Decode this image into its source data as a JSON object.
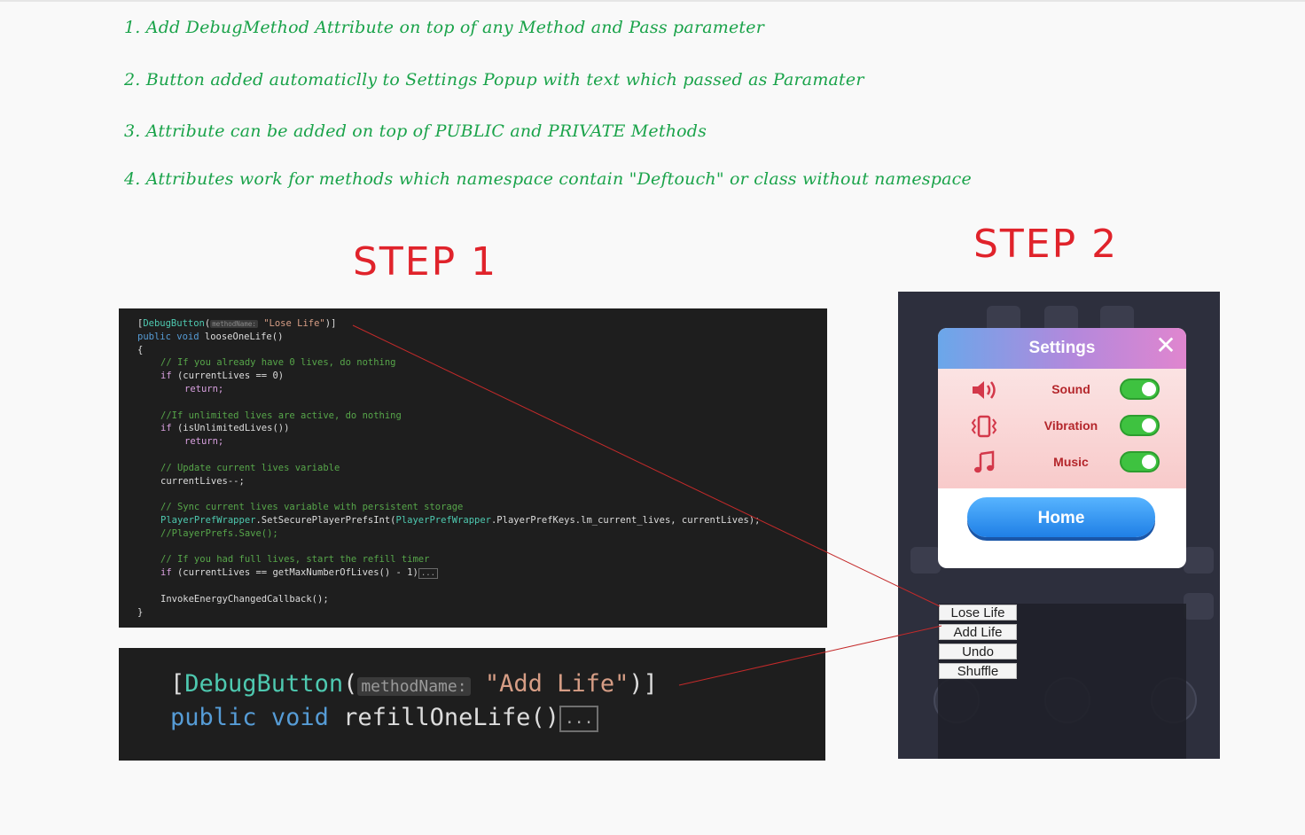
{
  "notes": [
    "1. Add DebugMethod Attribute on top of any Method and Pass parameter",
    "2. Button added automaticlly to Settings Popup with text which passed as Paramater",
    "3. Attribute can be added on top of PUBLIC and PRIVATE Methods",
    "4. Attributes work for methods which namespace contain \"Deftouch\" or class without namespace"
  ],
  "steps": {
    "step1": "STEP 1",
    "step2": "STEP 2"
  },
  "code1": {
    "attr_name": "DebugButton",
    "param_hint": "methodName:",
    "attr_value": "\"Lose Life\"",
    "lines": {
      "sig": "looseOneLife",
      "c1": "// If you already have 0 lives, do nothing",
      "l1": "(currentLives == 0)",
      "c2": "//If unlimited lives are active, do nothing",
      "l2": "(isUnlimitedLives())",
      "c3": "// Update current lives variable",
      "l3": "currentLives--;",
      "c4": "// Sync current lives variable with persistent storage",
      "l4a": "PlayerPrefWrapper",
      "l4b": ".SetSecurePlayerPrefsInt(",
      "l4c": "PlayerPrefWrapper",
      "l4d": ".PlayerPrefKeys.lm_current_lives, currentLives);",
      "c5": "//PlayerPrefs.Save();",
      "c6": "// If you had full lives, start the refill timer",
      "l6": "(currentLives == getMaxNumberOfLives() - 1)",
      "fold": "...",
      "l7": "InvokeEnergyChangedCallback();"
    }
  },
  "code2": {
    "attr_name": "DebugButton",
    "param_hint": "methodName:",
    "attr_value": "\"Add Life\"",
    "method": "refillOneLife",
    "fold": "..."
  },
  "settings_popup": {
    "title": "Settings",
    "rows": [
      {
        "label": "Sound",
        "icon": "speaker-icon",
        "enabled": true
      },
      {
        "label": "Vibration",
        "icon": "vibration-icon",
        "enabled": true
      },
      {
        "label": "Music",
        "icon": "music-note-icon",
        "enabled": true
      }
    ],
    "home_label": "Home"
  },
  "debug_buttons": [
    "Lose Life",
    "Add Life",
    "Undo",
    "Shuffle"
  ],
  "colors": {
    "note_green": "#1aa34a",
    "step_red": "#e0232b",
    "arrow_red": "#e03030",
    "toggle_green": "#3ec240"
  }
}
